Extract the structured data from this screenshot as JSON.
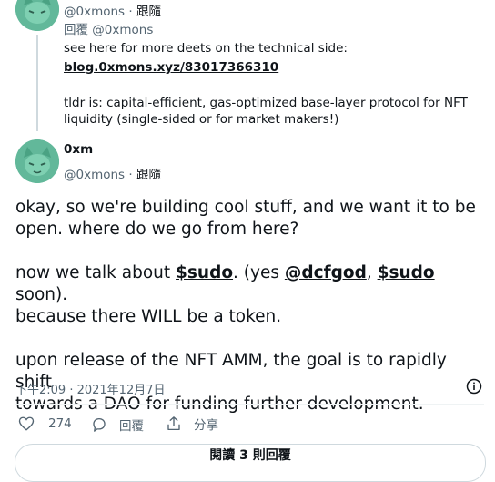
{
  "reply_tweet": {
    "handle": "@0xmons",
    "separator": "·",
    "follow_label": "跟隨",
    "replying_label": "回覆",
    "replying_to": "@0xmons",
    "line1": "see here for more deets on the technical side:",
    "link": "blog.0xmons.xyz/83017366310",
    "line3": "tldr is: capital-efficient, gas-optimized base-layer protocol for NFT",
    "line4": "liquidity (single-sided or for market makers!)"
  },
  "main_tweet": {
    "display_name": "0xm",
    "handle": "@0xmons",
    "separator": "·",
    "follow_label": "跟隨",
    "p1_line1": "okay, so we're building cool stuff, and we want it to be",
    "p1_line2": "open. where do we go from here?",
    "p2_a": "now we talk about ",
    "p2_sudo": "$sudo",
    "p2_b": ". (yes ",
    "p2_dcfgod": "@dcfgod",
    "p2_c": ", ",
    "p2_sudo2": "$sudo",
    "p2_d": " soon).",
    "p2_line2": "because there WILL be a token.",
    "p3_line1": "upon release of the NFT AMM, the goal is to rapidly shift",
    "p3_line2": "towards a DAO for funding further development.",
    "timestamp": "下午2:09 · 2021年12月7日",
    "info_icon": "info-icon"
  },
  "actions": {
    "like_count": "274",
    "reply_label": "回覆",
    "share_label": "分享"
  },
  "bottom_button": "閱讀 3 則回覆"
}
